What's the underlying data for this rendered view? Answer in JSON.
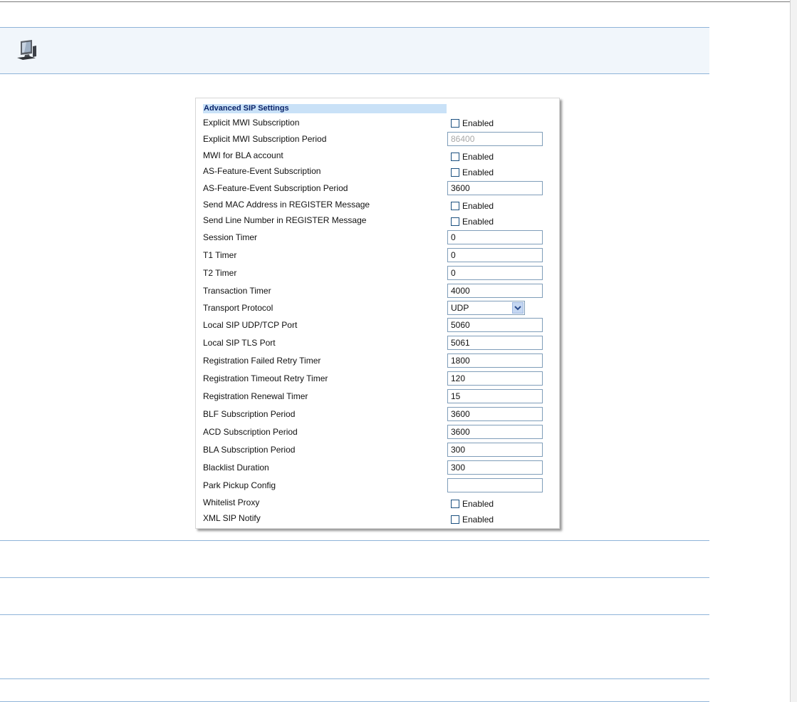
{
  "section": {
    "title": "Advanced SIP Settings"
  },
  "rows": [
    {
      "label": "Explicit MWI Subscription",
      "type": "checkbox",
      "checkbox_label": "Enabled"
    },
    {
      "label": "Explicit MWI Subscription Period",
      "type": "text",
      "value": "86400",
      "disabled": true
    },
    {
      "label": "MWI for BLA account",
      "type": "checkbox",
      "checkbox_label": "Enabled"
    },
    {
      "label": "AS-Feature-Event Subscription",
      "type": "checkbox",
      "checkbox_label": "Enabled"
    },
    {
      "label": "AS-Feature-Event Subscription Period",
      "type": "text",
      "value": "3600"
    },
    {
      "label": "Send MAC Address in REGISTER Message",
      "type": "checkbox",
      "checkbox_label": "Enabled"
    },
    {
      "label": "Send Line Number in REGISTER Message",
      "type": "checkbox",
      "checkbox_label": "Enabled"
    },
    {
      "label": "Session Timer",
      "type": "text",
      "value": "0"
    },
    {
      "label": "T1 Timer",
      "type": "text",
      "value": "0"
    },
    {
      "label": "T2 Timer",
      "type": "text",
      "value": "0"
    },
    {
      "label": "Transaction Timer",
      "type": "text",
      "value": "4000"
    },
    {
      "label": "Transport Protocol",
      "type": "select",
      "value": "UDP"
    },
    {
      "label": "Local SIP UDP/TCP Port",
      "type": "text",
      "value": "5060"
    },
    {
      "label": "Local SIP TLS Port",
      "type": "text",
      "value": "5061"
    },
    {
      "label": "Registration Failed Retry Timer",
      "type": "text",
      "value": "1800"
    },
    {
      "label": "Registration Timeout Retry Timer",
      "type": "text",
      "value": "120"
    },
    {
      "label": "Registration Renewal Timer",
      "type": "text",
      "value": "15"
    },
    {
      "label": "BLF Subscription Period",
      "type": "text",
      "value": "3600"
    },
    {
      "label": "ACD Subscription Period",
      "type": "text",
      "value": "3600"
    },
    {
      "label": "BLA Subscription Period",
      "type": "text",
      "value": "300"
    },
    {
      "label": "Blacklist Duration",
      "type": "text",
      "value": "300"
    },
    {
      "label": "Park Pickup Config",
      "type": "text",
      "value": ""
    },
    {
      "label": "Whitelist Proxy",
      "type": "checkbox",
      "checkbox_label": "Enabled"
    },
    {
      "label": "XML SIP Notify",
      "type": "checkbox",
      "checkbox_label": "Enabled"
    }
  ],
  "icons": {
    "banner": "computer-workstation-icon",
    "select_arrow": "chevron-down-icon"
  },
  "colors": {
    "banner_bg": "#f1f6fb",
    "rule": "#8fb4d9",
    "title_bg": "#c9e1f7",
    "title_text": "#0a246a"
  }
}
